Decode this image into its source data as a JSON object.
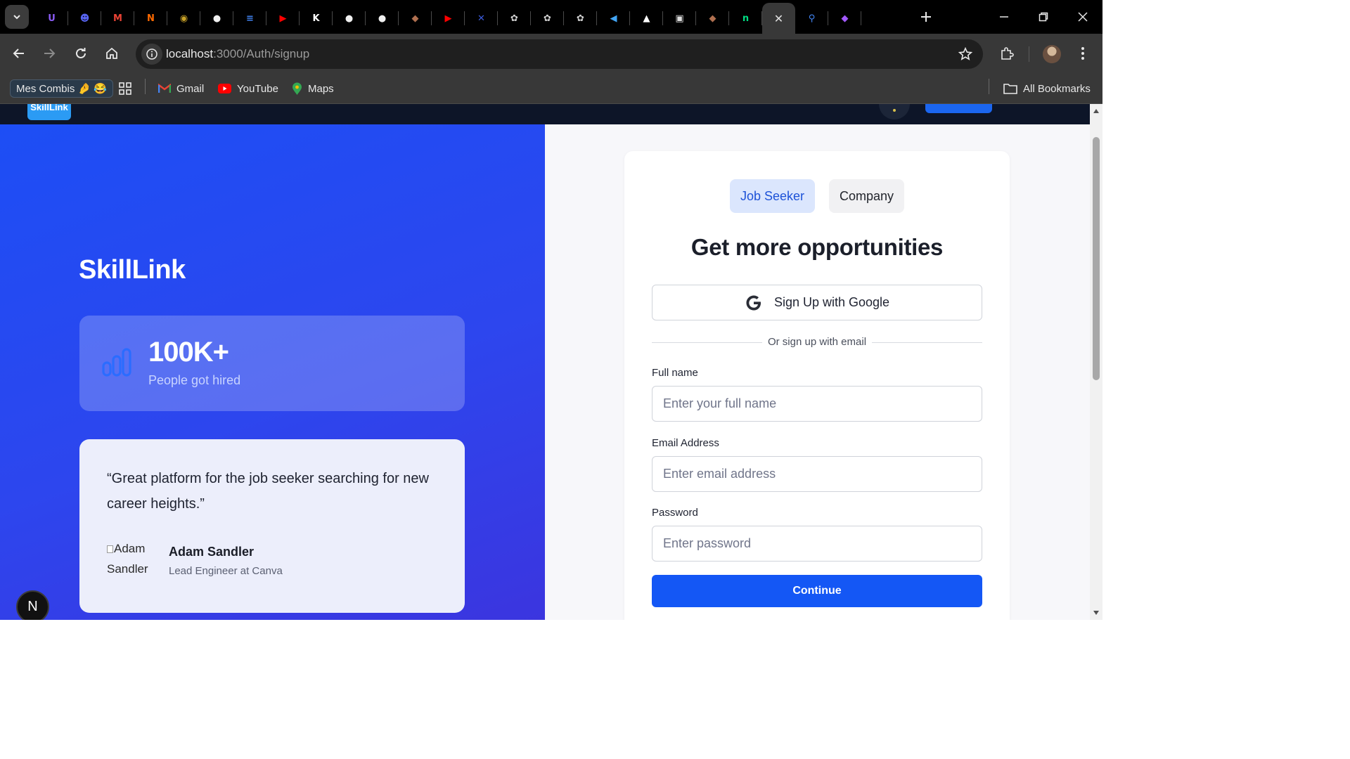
{
  "browser": {
    "tabs": [
      {
        "icon": "onedrive-u-icon",
        "color": "#8b5cf6",
        "glyph": "U"
      },
      {
        "icon": "discord-icon",
        "color": "#5865f2",
        "glyph": "☻"
      },
      {
        "icon": "gmail-icon",
        "color": "#ea4335",
        "glyph": "M"
      },
      {
        "icon": "artstation-icon",
        "color": "#ff6a00",
        "glyph": "N"
      },
      {
        "icon": "globe-badge-icon",
        "color": "#c9a227",
        "glyph": "◉"
      },
      {
        "icon": "github-icon",
        "color": "#f0f0f0",
        "glyph": "●"
      },
      {
        "icon": "google-docs-icon",
        "color": "#4285f4",
        "glyph": "≡"
      },
      {
        "icon": "youtube-icon",
        "color": "#ff0000",
        "glyph": "▶"
      },
      {
        "icon": "framer-icon",
        "color": "#ffffff",
        "glyph": "K"
      },
      {
        "icon": "github-icon",
        "color": "#f0f0f0",
        "glyph": "●"
      },
      {
        "icon": "github-icon",
        "color": "#f0f0f0",
        "glyph": "●"
      },
      {
        "icon": "anime-avatar-icon",
        "color": "#b07050",
        "glyph": "◆"
      },
      {
        "icon": "youtube-icon",
        "color": "#ff0000",
        "glyph": "▶"
      },
      {
        "icon": "cursor-app-icon",
        "color": "#3b5bdb",
        "glyph": "✕"
      },
      {
        "icon": "chatgpt-icon",
        "color": "#d0d0d0",
        "glyph": "✿"
      },
      {
        "icon": "chatgpt-icon",
        "color": "#d0d0d0",
        "glyph": "✿"
      },
      {
        "icon": "chatgpt-icon",
        "color": "#d0d0d0",
        "glyph": "✿"
      },
      {
        "icon": "flutter-icon",
        "color": "#42a5f5",
        "glyph": "◀"
      },
      {
        "icon": "vercel-icon",
        "color": "#ffffff",
        "glyph": "▲"
      },
      {
        "icon": "monitor-icon",
        "color": "#e0e0e0",
        "glyph": "▣"
      },
      {
        "icon": "anime-avatar-icon",
        "color": "#b07050",
        "glyph": "◆"
      },
      {
        "icon": "nuxt-icon",
        "color": "#00dc82",
        "glyph": "n"
      },
      {
        "icon": "close-icon",
        "color": "#e0e0e0",
        "glyph": "✕",
        "active": true
      },
      {
        "icon": "search-icon",
        "color": "#4285f4",
        "glyph": "⚲"
      },
      {
        "icon": "figma-icon",
        "color": "#a259ff",
        "glyph": "◆"
      }
    ],
    "url_host": "localhost",
    "url_path": ":3000/Auth/signup",
    "bookmarks": {
      "combis_label": "Mes Combis 🤌 😂",
      "gmail_label": "Gmail",
      "youtube_label": "YouTube",
      "maps_label": "Maps",
      "all_bookmarks_label": "All Bookmarks"
    }
  },
  "site": {
    "nav_logo": "SkillLink",
    "brand": "SkillLink",
    "stat": {
      "value": "100K+",
      "label": "People got hired"
    },
    "testimonial": {
      "quote": "“Great platform for the job seeker searching for new career heights.”",
      "avatar_alt": "Adam Sandler",
      "name": "Adam Sandler",
      "role": "Lead Engineer at Canva"
    },
    "next_badge": "N"
  },
  "form": {
    "tabs": {
      "job_seeker": "Job Seeker",
      "company": "Company"
    },
    "title": "Get more opportunities",
    "google_label": "Sign Up with Google",
    "divider": "Or sign up with email",
    "fields": {
      "full_name": {
        "label": "Full name",
        "placeholder": "Enter your full name",
        "value": ""
      },
      "email": {
        "label": "Email Address",
        "placeholder": "Enter email address",
        "value": ""
      },
      "password": {
        "label": "Password",
        "placeholder": "Enter password",
        "value": ""
      }
    },
    "continue_label": "Continue"
  },
  "colors": {
    "primary": "#1457f5",
    "panel_gradient_start": "#1d4ef5",
    "panel_gradient_end": "#3b35df",
    "active_tab_bg": "#dbe6fd"
  }
}
